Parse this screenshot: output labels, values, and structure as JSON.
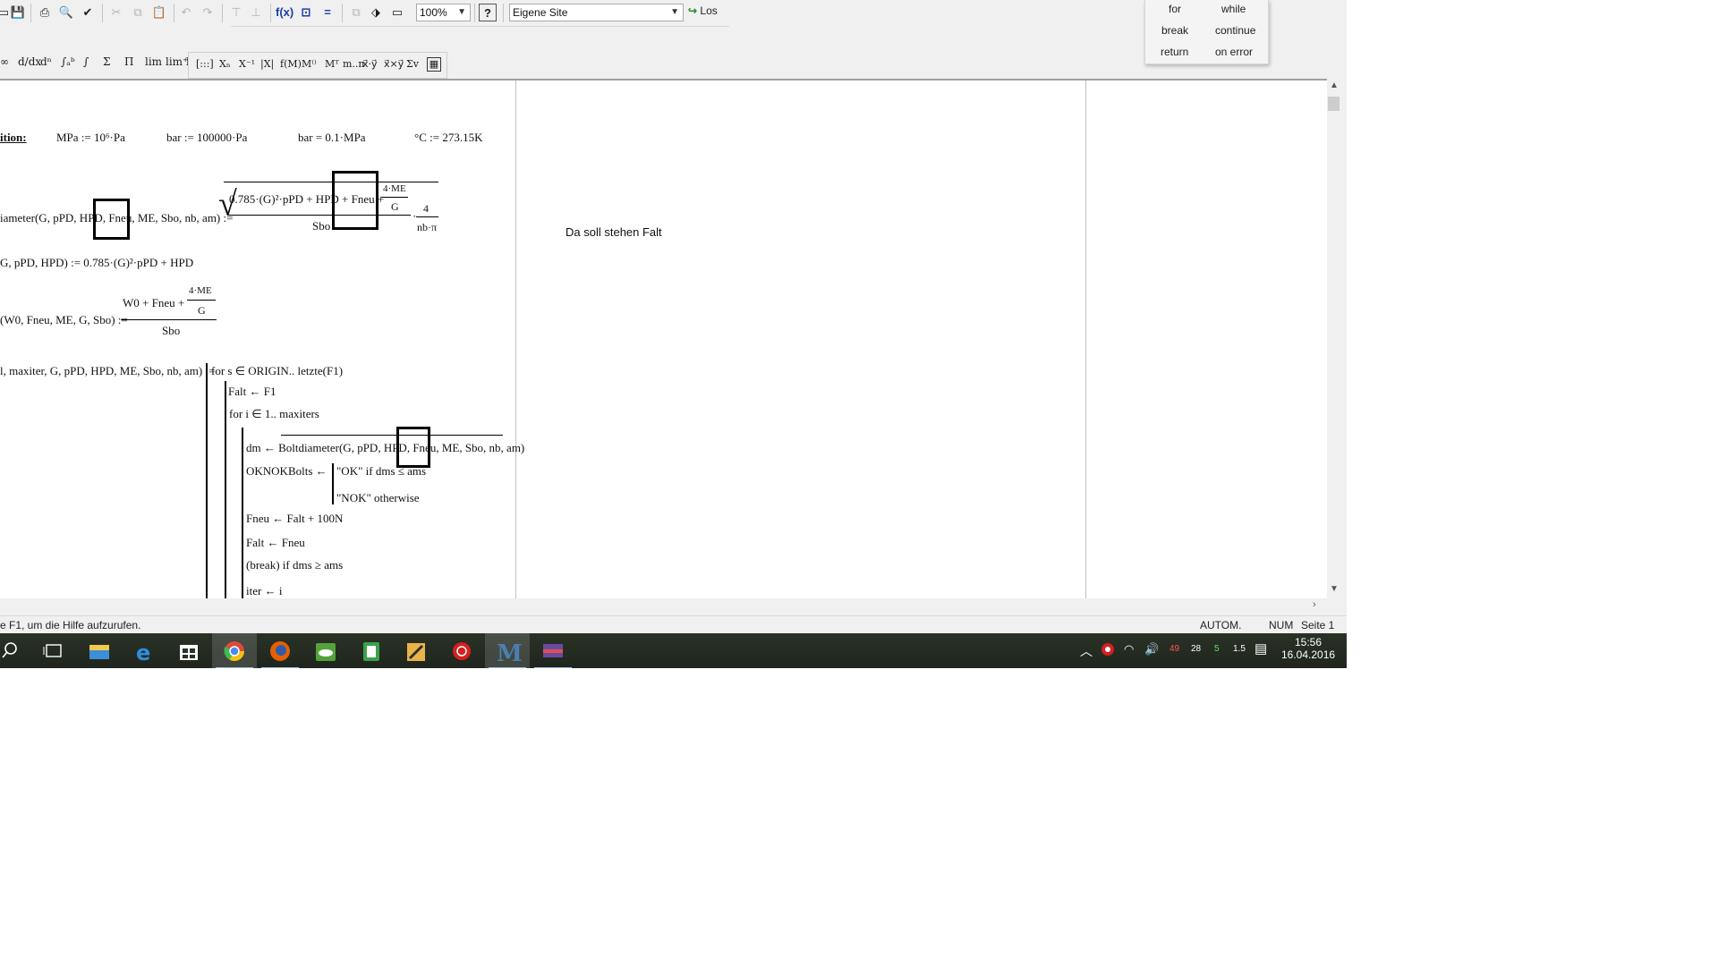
{
  "toolbar": {
    "zoom": "100%",
    "site": "Eigene Site",
    "go_label": "Los"
  },
  "popup": {
    "for": "for",
    "while": "while",
    "break": "break",
    "continue": "continue",
    "return": "return",
    "on_error": "on error"
  },
  "worksheet": {
    "def_label": "ition:",
    "unit_mpa": "MPa := 10⁶·Pa",
    "unit_bar": "bar := 100000·Pa",
    "unit_bar_eval": "bar = 0.1·MPa",
    "unit_celsius": "°C := 273.15K",
    "boltdiam_lhs": "iameter(G, pPD, HPD, Fneu, ME, Sbo, nb, am) :=",
    "boltdiam_num": "0.785·(G)²·pPD + HPD + Fneu +",
    "boltdiam_frac_num": "4·ME",
    "boltdiam_frac_den": "G",
    "boltdiam_den": "Sbo",
    "boltdiam_4": "4",
    "boltdiam_npi": "nb·π",
    "w0_def": "G, pPD, HPD) := 0.785·(G)²·pPD + HPD",
    "f_lhs": "(W0, Fneu, ME, G, Sbo) :=",
    "f_num": "W0 + Fneu +",
    "f_frac_num": "4·ME",
    "f_frac_den": "G",
    "f_den": "Sbo",
    "prog_lhs": "l, maxiter, G, pPD, HPD, ME, Sbo, nb, am) :=",
    "prog_for_s": "for s ∈ ORIGIN.. letzte(F1)",
    "prog_falt": "Falt ← F1",
    "prog_for_i": "for i ∈ 1.. maxiters",
    "prog_dm": "dm ← Boltdiameter(G, pPD, HPD, Fneu, ME, Sbo, nb, am)",
    "prog_oknok": "OKNOKBolts ←",
    "prog_ok": "\"OK\"  if  dms ≤ ams",
    "prog_nok": "\"NOK\"  otherwise",
    "prog_fneu": "Fneu ← Falt + 100N",
    "prog_falt2": "Falt ← Fneu",
    "prog_break": "(break)  if  dms ≥ ams",
    "prog_iter": "iter ← i",
    "note": "Da soll stehen Falt"
  },
  "status": {
    "help": "e F1, um die Hilfe aufzurufen.",
    "mode": "AUTOM.",
    "num": "NUM",
    "page": "Seite 1"
  },
  "taskbar": {
    "time": "15:56",
    "date": "16.04.2016",
    "tray_nums": [
      "49",
      "28",
      "5",
      "1.5"
    ]
  }
}
